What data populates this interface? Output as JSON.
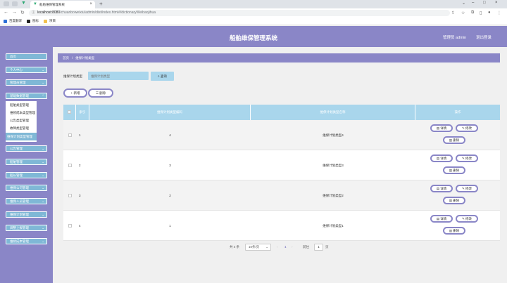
{
  "browser": {
    "tab_title": "船舶维保管理系统",
    "new_tab": "+",
    "url_host": "localhost:8080",
    "url_path": "/chuanboweixiu/admin/dist/index.html#/dictionaryWeibaojihua",
    "bookmarks": [
      "百度翻译",
      "图标",
      "项目"
    ]
  },
  "header": {
    "title": "船舶维保管理系统",
    "user": "管理员 admin",
    "logout": "退出登录"
  },
  "sidebar": {
    "items": [
      {
        "label": "首页",
        "chevron": false
      },
      {
        "label": "个人中心",
        "chevron": true
      },
      {
        "label": "管理员管理",
        "chevron": true
      },
      {
        "label": "基础数据管理",
        "chevron": true
      },
      {
        "label": "公告管理",
        "chevron": true
      },
      {
        "label": "船舶管理",
        "chevron": true
      },
      {
        "label": "船长管理",
        "chevron": true
      },
      {
        "label": "维保公司管理",
        "chevron": true
      },
      {
        "label": "维保人员管理",
        "chevron": true
      },
      {
        "label": "维保计划管理",
        "chevron": true
      },
      {
        "label": "调整上报管理",
        "chevron": true
      },
      {
        "label": "维修成本管理",
        "chevron": true
      }
    ],
    "submenu": [
      "船舶类型管理",
      "维修成本类型管理",
      "公告类型管理",
      "故障类型管理",
      "维保计划类型管理"
    ]
  },
  "breadcrumb": {
    "home": "首页",
    "sep": "/",
    "current": "维保计划类型"
  },
  "search": {
    "label": "维保计划类型",
    "placeholder": "维保计划类型",
    "button": "查询"
  },
  "toolbar": {
    "add": "新增",
    "delete": "删除"
  },
  "table": {
    "columns": [
      "索引",
      "维保计划类型编码",
      "维保计划类型名称",
      "操作"
    ],
    "rows": [
      {
        "index": "1",
        "code": "4",
        "name": "维保计划类型4"
      },
      {
        "index": "2",
        "code": "3",
        "name": "维保计划类型3"
      },
      {
        "index": "3",
        "code": "2",
        "name": "维保计划类型2"
      },
      {
        "index": "4",
        "code": "1",
        "name": "维保计划类型1"
      }
    ],
    "actions": {
      "detail": "详情",
      "edit": "修改",
      "delete": "删除"
    }
  },
  "pager": {
    "total": "共 4 条",
    "page_size": "10条/页",
    "prev": "‹",
    "current": "1",
    "next": "›",
    "goto_label": "前往",
    "goto_value": "1",
    "page_unit": "页"
  },
  "colors": {
    "primary": "#8a86c7",
    "accent": "#a9d6ec",
    "menu": "#7fb8d6"
  }
}
